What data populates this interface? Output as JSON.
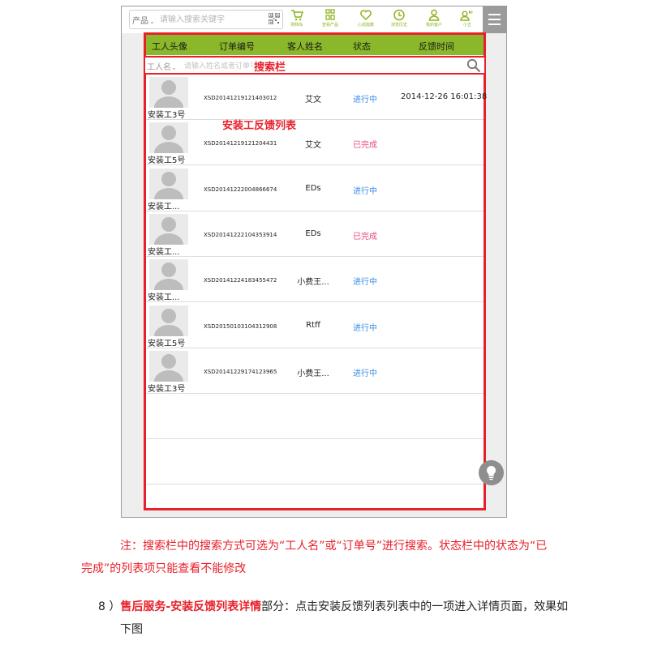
{
  "top_search": {
    "category": "产品",
    "placeholder": "请输入搜索关键字"
  },
  "nav_items": [
    {
      "label": "购物车",
      "icon": "cart-icon"
    },
    {
      "label": "查看产品",
      "icon": "products-icon"
    },
    {
      "label": "心动指数",
      "icon": "heart-icon"
    },
    {
      "label": "浏览历史",
      "icon": "clock-icon"
    },
    {
      "label": "我的客户",
      "icon": "person-icon"
    },
    {
      "label": "小五",
      "icon": "voice-person-icon"
    }
  ],
  "table_header": {
    "avatar": "工人头像",
    "order_no": "订单编号",
    "customer": "客人姓名",
    "status": "状态",
    "feedback_time": "反馈时间"
  },
  "list_search": {
    "category": "工人名",
    "placeholder": "请输入姓名或者订单号",
    "annotation": "搜索栏"
  },
  "list_annotation": "安装工反馈列表",
  "rows": [
    {
      "worker": "安装工3号",
      "order_no": "XSD20141219121403012",
      "customer": "艾文",
      "status": "进行中",
      "status_color": "#3b8be6",
      "time": "2014-12-26 16:01:38"
    },
    {
      "worker": "安装工5号",
      "order_no": "XSD20141219121204431",
      "customer": "艾文",
      "status": "已完成",
      "status_color": "#e8487c",
      "time": ""
    },
    {
      "worker": "安装工...",
      "order_no": "XSD20141222004866674",
      "customer": "EDs",
      "status": "进行中",
      "status_color": "#3b8be6",
      "time": ""
    },
    {
      "worker": "安装工...",
      "order_no": "XSD20141222104353914",
      "customer": "EDs",
      "status": "已完成",
      "status_color": "#e8487c",
      "time": ""
    },
    {
      "worker": "安装工...",
      "order_no": "XSD20141224183455472",
      "customer": "小费王...",
      "status": "进行中",
      "status_color": "#3b8be6",
      "time": ""
    },
    {
      "worker": "安装工5号",
      "order_no": "XSD20150103104312908",
      "customer": "Rtff",
      "status": "进行中",
      "status_color": "#3b8be6",
      "time": ""
    },
    {
      "worker": "安装工3号",
      "order_no": "XSD20141229174123965",
      "customer": "小费王...",
      "status": "进行中",
      "status_color": "#3b8be6",
      "time": ""
    }
  ],
  "colors": {
    "accent_green": "#8ab82a",
    "annotation_red": "#e8202a",
    "in_progress": "#3b8be6",
    "completed": "#e8487c"
  },
  "note_line1": "注：搜索栏中的搜索方式可选为“工人名”或“订单号”进行搜索。状态栏中的状态为“已",
  "note_line2": "完成”的列表项只能查看不能修改",
  "step": {
    "prefix": "8 ）",
    "highlight": "售后服务-安装反馈列表详情",
    "text_part1": "部分：点击安装反馈列表列表中的一项进入详情页面，效果如",
    "text_part2": "下图"
  }
}
